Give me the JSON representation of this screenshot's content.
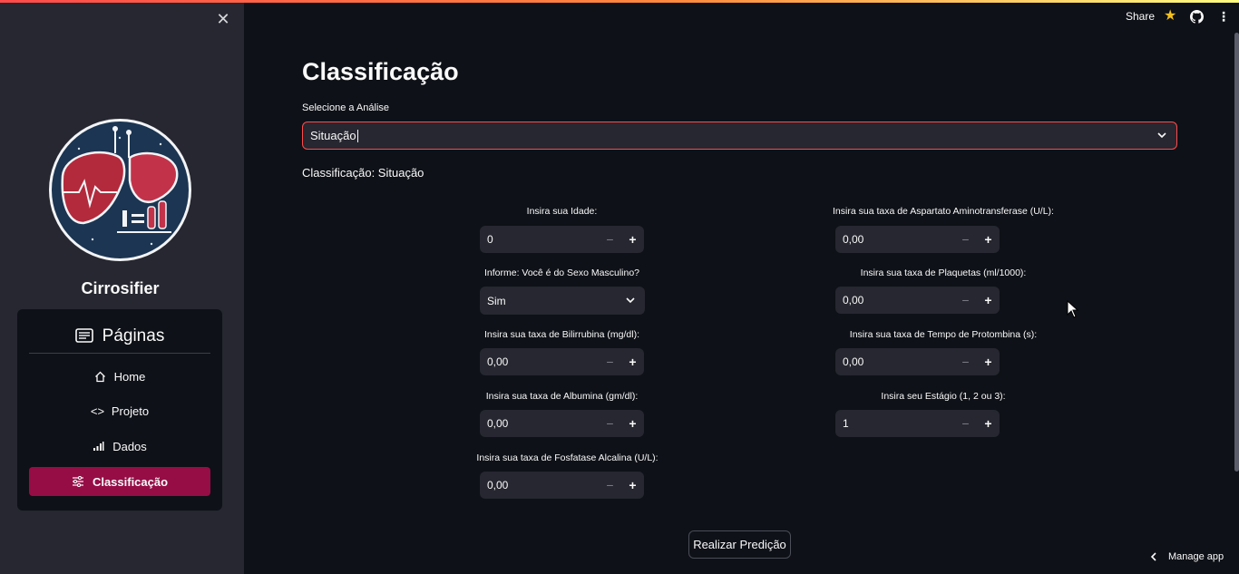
{
  "header": {
    "share_label": "Share",
    "accent_color": "#ff4b4b",
    "star_color": "#f4c020",
    "icons": [
      "star-icon",
      "github-icon",
      "kebab-menu-icon"
    ]
  },
  "sidebar": {
    "app_name": "Cirrosifier",
    "nav_title": "Páginas",
    "nav_items": [
      {
        "label": "Home",
        "icon": "home-icon",
        "active": false
      },
      {
        "label": "Projeto",
        "icon": "code-icon",
        "active": false
      },
      {
        "label": "Dados",
        "icon": "bar-chart-icon",
        "active": false
      },
      {
        "label": "Classificação",
        "icon": "sliders-icon",
        "active": true
      }
    ],
    "active_color": "#960d46"
  },
  "main": {
    "title": "Classificação",
    "select_label": "Selecione a Análise",
    "select_value": "Situação",
    "subtitle": "Classificação: Situação",
    "left_fields": [
      {
        "label": "Insira sua Idade:",
        "type": "number",
        "value": "0"
      },
      {
        "label": "Informe: Você é do Sexo Masculino?",
        "type": "select",
        "value": "Sim"
      },
      {
        "label": "Insira sua taxa de Bilirrubina (mg/dl):",
        "type": "number",
        "value": "0,00"
      },
      {
        "label": "Insira sua taxa de Albumina (gm/dl):",
        "type": "number",
        "value": "0,00"
      },
      {
        "label": "Insira sua taxa de Fosfatase Alcalina (U/L):",
        "type": "number",
        "value": "0,00"
      }
    ],
    "right_fields": [
      {
        "label": "Insira sua taxa de Aspartato Aminotransferase (U/L):",
        "type": "number",
        "value": "0,00"
      },
      {
        "label": "Insira sua taxa de Plaquetas (ml/1000):",
        "type": "number",
        "value": "0,00"
      },
      {
        "label": "Insira sua taxa de Tempo de Protombina (s):",
        "type": "number",
        "value": "0,00"
      },
      {
        "label": "Insira seu Estágio (1, 2 ou 3):",
        "type": "number",
        "value": "1"
      }
    ],
    "stepper_minus": "−",
    "stepper_plus": "+",
    "predict_button": "Realizar Predição"
  },
  "footer": {
    "manage_app": "Manage app"
  }
}
